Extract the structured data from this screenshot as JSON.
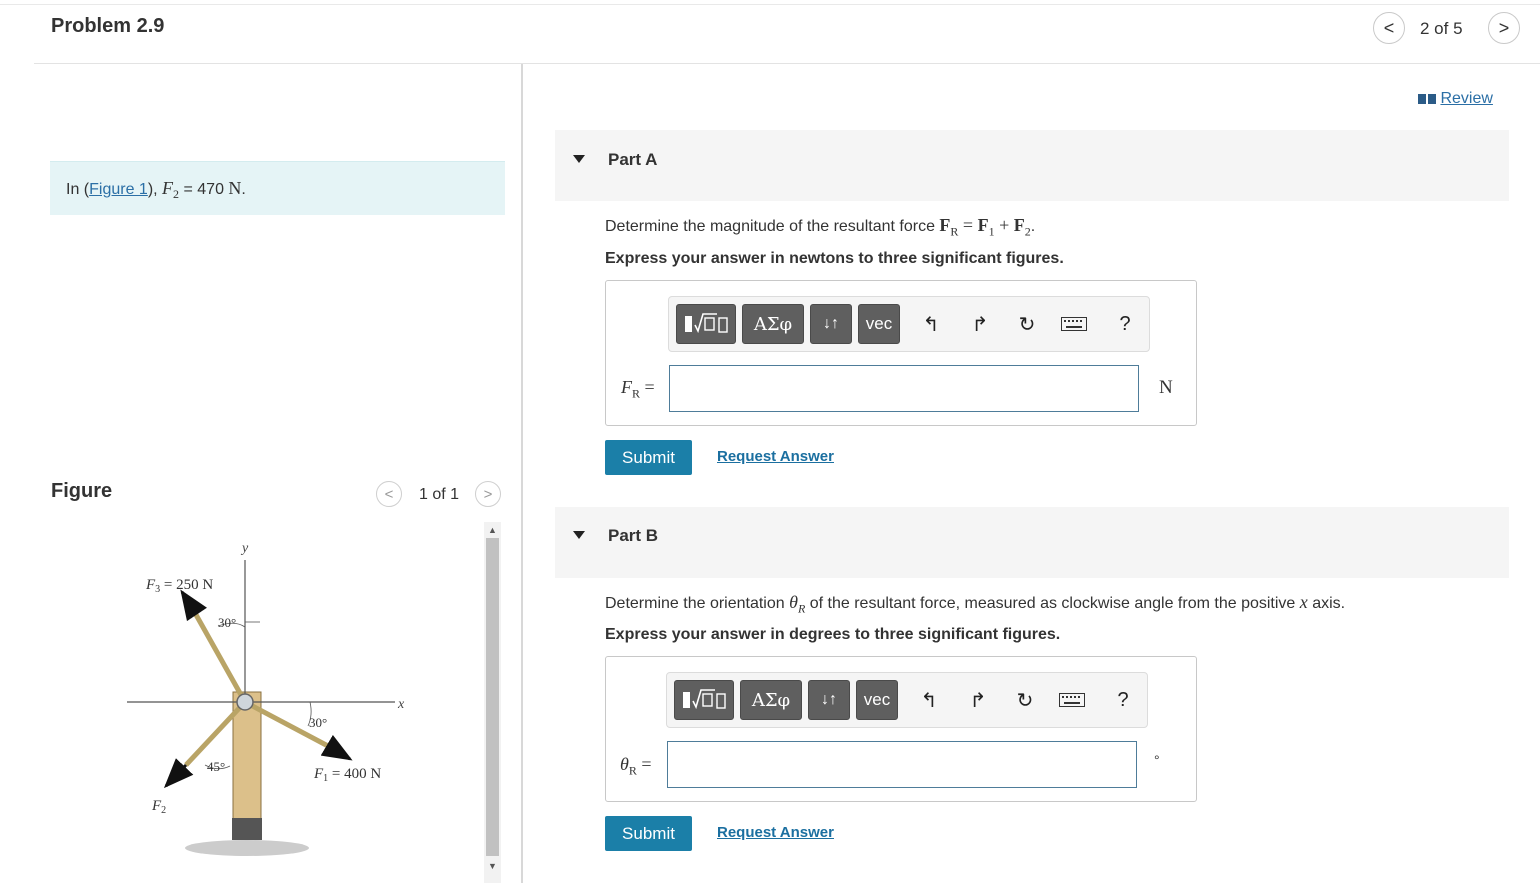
{
  "header": {
    "title": "Problem 2.9",
    "nav_count": "2 of 5",
    "prev_glyph": "<",
    "next_glyph": ">"
  },
  "problem": {
    "prefix": "In (",
    "figure_link": "Figure 1",
    "suffix": "), ",
    "var": "F",
    "var_sub": "2",
    "eq": " = 470 ",
    "unit": "N",
    "end": "."
  },
  "figure_panel": {
    "heading": "Figure",
    "count": "1 of 1",
    "labels": {
      "y": "y",
      "x": "x",
      "f3": "F",
      "f3_sub": "3",
      "f3_val": " = 250 N",
      "angle1": "30°",
      "angle2": "30°",
      "angle3": "45°",
      "f1": "F",
      "f1_sub": "1",
      "f1_val": " = 400 N",
      "f2": "F",
      "f2_sub": "2"
    }
  },
  "review": {
    "label": "Review",
    "icon": "book-icon"
  },
  "parts": [
    {
      "title": "Part A",
      "question_prefix": "Determine the magnitude of the resultant force ",
      "question_math": "FR = F1 + F2",
      "question_suffix": ".",
      "instruction": "Express your answer in newtons to three significant figures.",
      "answer_label": "FR =",
      "unit": "N",
      "submit_label": "Submit",
      "request_label": "Request Answer"
    },
    {
      "title": "Part B",
      "question_prefix": "Determine the orientation ",
      "question_math": "θR",
      "question_mid": " of the resultant force, measured as clockwise angle from the positive ",
      "question_math2": "x",
      "question_suffix": " axis.",
      "instruction": "Express your answer in degrees to three significant figures.",
      "answer_label": "θR =",
      "unit": "°",
      "submit_label": "Submit",
      "request_label": "Request Answer"
    }
  ],
  "toolbar": {
    "greek": "ΑΣφ",
    "arrows": "↓↑",
    "vec": "vec",
    "help": "?",
    "icons": [
      "templates-icon",
      "greek-icon",
      "subscript-icon",
      "vector-icon",
      "undo-icon",
      "redo-icon",
      "reset-icon",
      "keyboard-icon",
      "help-icon"
    ]
  }
}
